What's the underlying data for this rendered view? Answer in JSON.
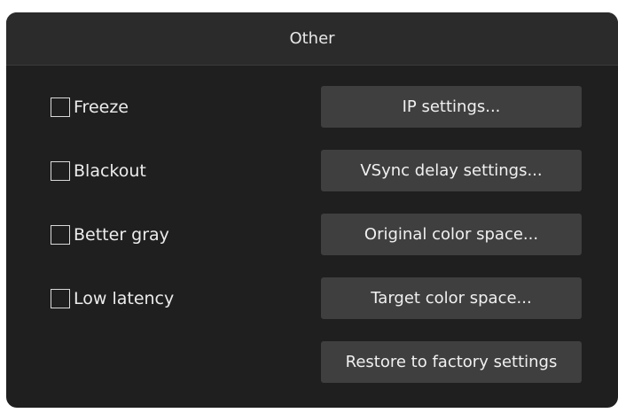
{
  "panel": {
    "title": "Other"
  },
  "checkboxes": [
    {
      "label": "Freeze",
      "checked": false
    },
    {
      "label": "Blackout",
      "checked": false
    },
    {
      "label": "Better gray",
      "checked": false
    },
    {
      "label": "Low latency",
      "checked": false
    }
  ],
  "buttons": [
    {
      "label": "IP settings..."
    },
    {
      "label": "VSync delay settings..."
    },
    {
      "label": "Original color space..."
    },
    {
      "label": "Target color space..."
    },
    {
      "label": "Restore to factory settings"
    }
  ],
  "colors": {
    "panel_bg": "#1f1f1f",
    "header_bg": "#2b2b2b",
    "button_bg": "#3f3f3f",
    "text": "#ececec"
  }
}
